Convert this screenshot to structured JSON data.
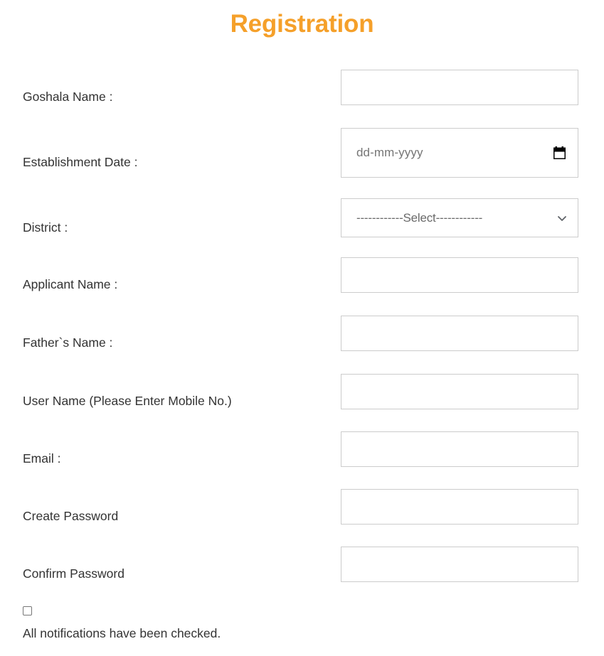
{
  "page": {
    "title": "Registration",
    "accent_color": "#f5a02a",
    "label_color": "#333333",
    "field_border_color": "#cccccc"
  },
  "form": {
    "rows": [
      {
        "label": "Goshala Name :",
        "name": "goshala-name",
        "control": "text",
        "value": "",
        "placeholder": ""
      },
      {
        "label": "Establishment Date :",
        "name": "establishment-date",
        "control": "date",
        "value": "",
        "placeholder": "dd-mm-yyyy",
        "icon": "calendar-icon"
      },
      {
        "label": "District :",
        "name": "district",
        "control": "select",
        "value": "------------Select------------",
        "icon": "chevron-down-icon"
      },
      {
        "label": "Applicant Name :",
        "name": "applicant-name",
        "control": "text",
        "value": "",
        "placeholder": ""
      },
      {
        "label": "Father`s Name :",
        "name": "fathers-name",
        "control": "text",
        "value": "",
        "placeholder": ""
      },
      {
        "label": "User Name (Please Enter Mobile No.)",
        "name": "user-name",
        "control": "text",
        "value": "",
        "placeholder": ""
      },
      {
        "label": "Email :",
        "name": "email",
        "control": "text",
        "value": "",
        "placeholder": ""
      },
      {
        "label": "Create Password",
        "name": "create-password",
        "control": "text",
        "value": "",
        "placeholder": ""
      },
      {
        "label": "Confirm Password",
        "name": "confirm-password",
        "control": "text",
        "value": "",
        "placeholder": ""
      }
    ]
  },
  "notifications": {
    "checkbox_checked": false,
    "label": "All notifications have been checked."
  }
}
